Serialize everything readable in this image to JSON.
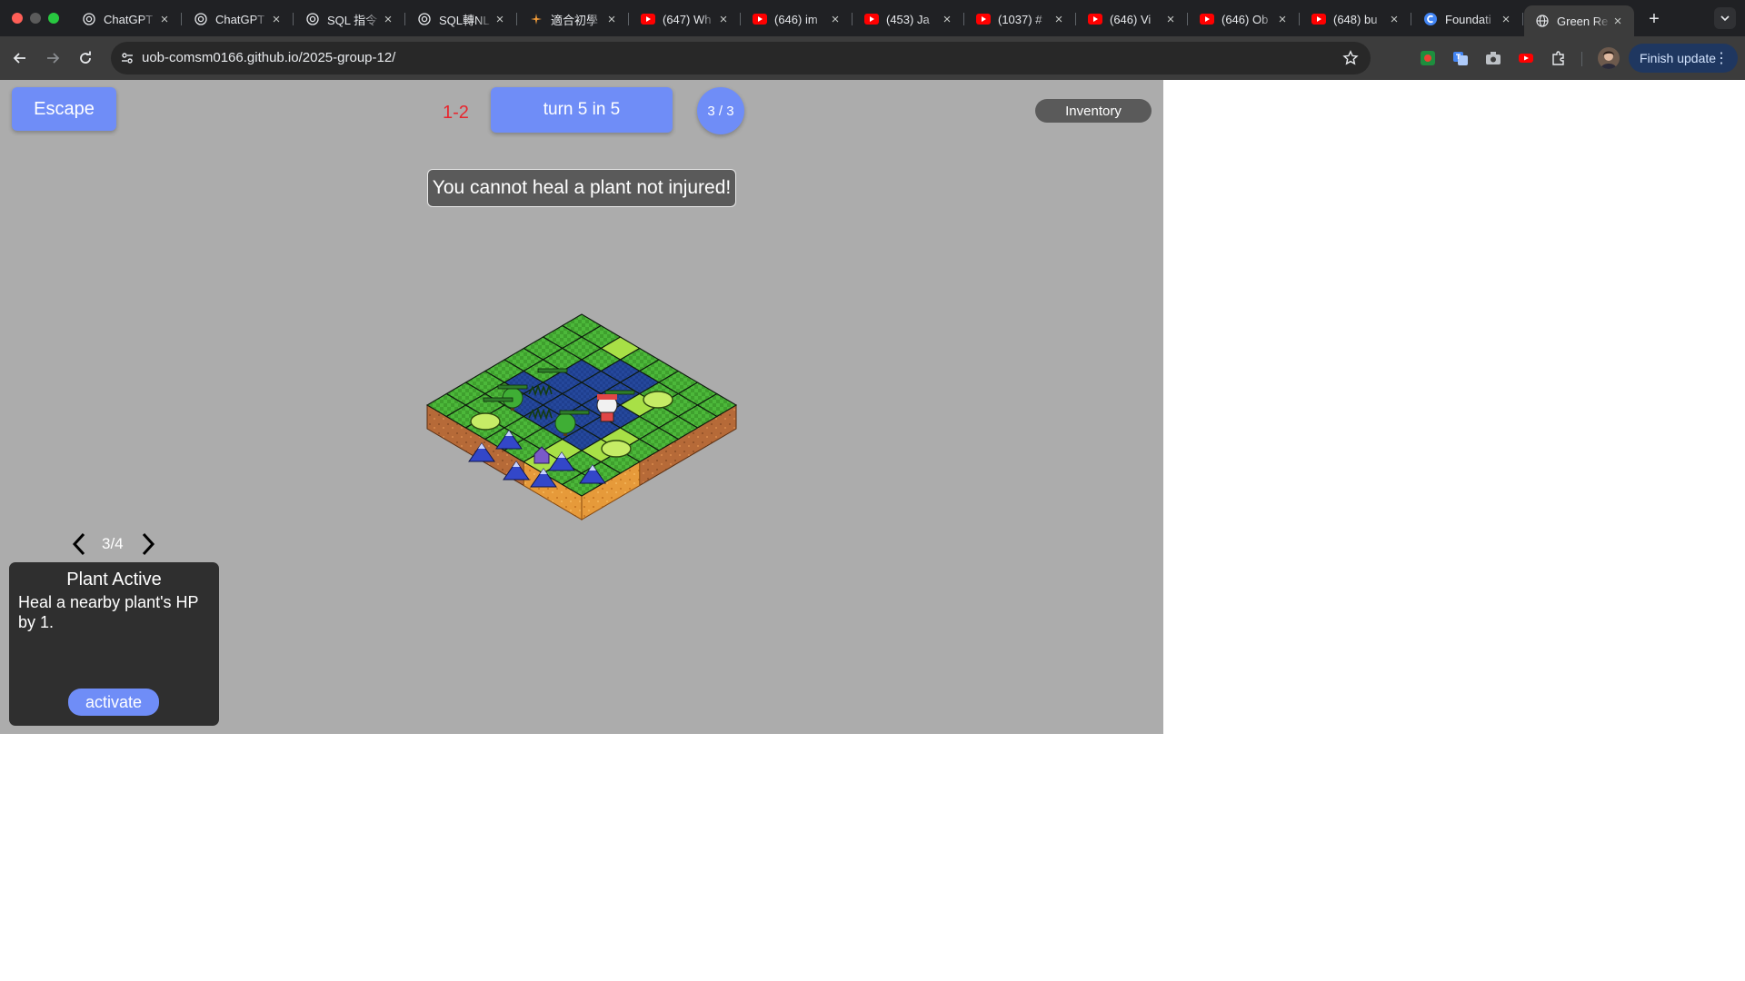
{
  "browser": {
    "tabs": [
      {
        "title": "ChatGPT",
        "icon": "openai-icon"
      },
      {
        "title": "ChatGPT",
        "icon": "openai-icon"
      },
      {
        "title": "SQL 指令",
        "icon": "openai-icon"
      },
      {
        "title": "SQL轉NL",
        "icon": "openai-icon"
      },
      {
        "title": "適合初學",
        "icon": "sparkle-icon"
      },
      {
        "title": "(647) Wh",
        "icon": "youtube-icon"
      },
      {
        "title": "(646) im",
        "icon": "youtube-icon"
      },
      {
        "title": "(453) Ja",
        "icon": "youtube-icon"
      },
      {
        "title": "(1037) #",
        "icon": "youtube-icon"
      },
      {
        "title": "(646) Vi",
        "icon": "youtube-icon"
      },
      {
        "title": "(646) Ob",
        "icon": "youtube-icon"
      },
      {
        "title": "(648) bu",
        "icon": "youtube-icon"
      },
      {
        "title": "Foundati",
        "icon": "c-icon"
      },
      {
        "title": "Green Re",
        "icon": "globe-icon",
        "active": true
      }
    ],
    "new_tab_label": "+",
    "url_host": "uob-comsm0166.github.io",
    "url_path": "/2025-group-12/",
    "update_label": "Finish update",
    "colors": {
      "youtube": "#ff0000",
      "active_tab": "#3c3c3c",
      "tab_strip": "#202124"
    }
  },
  "game": {
    "escape_label": "Escape",
    "level": "1-2",
    "turn_label": "turn 5 in 5",
    "action_counter": "3 / 3",
    "inventory_label": "Inventory",
    "toast_message": "You cannot heal a plant not injured!",
    "card_pager": {
      "current": 3,
      "total": 4,
      "text": "3/4"
    },
    "card": {
      "title": "Plant Active",
      "description": "Heal a nearby plant's HP by 1.",
      "button_label": "activate"
    },
    "colors": {
      "accent": "#6f8df7",
      "level": "#e8262e",
      "background": "#acacac"
    }
  }
}
